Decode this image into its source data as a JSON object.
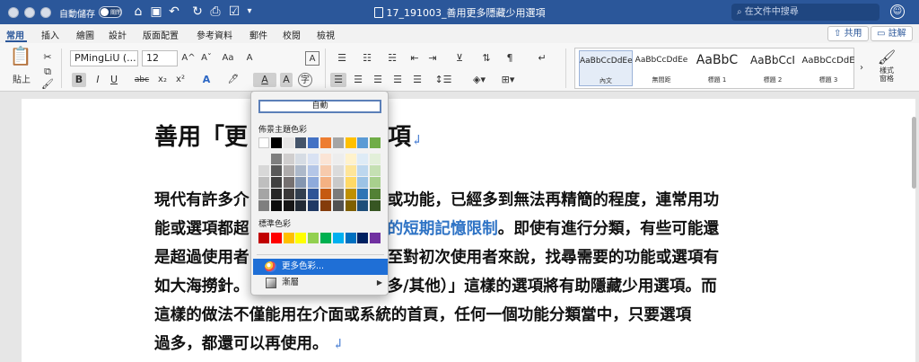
{
  "titlebar": {
    "autosave_label": "自動儲存",
    "autosave_state": "關閉",
    "doc_title": "17_191003_善用更多隱藏少用選項",
    "search_placeholder": "在文件中搜尋",
    "search_icon": "search-icon",
    "account_icon": "account-icon",
    "icons": [
      "home-icon",
      "save-icon",
      "undo-icon",
      "redo-icon",
      "print-icon",
      "checklist-icon",
      "dropdown-icon"
    ]
  },
  "tabs": [
    {
      "label": "常用",
      "active": true
    },
    {
      "label": "插入"
    },
    {
      "label": "繪圖"
    },
    {
      "label": "設計"
    },
    {
      "label": "版面配置"
    },
    {
      "label": "參考資料"
    },
    {
      "label": "郵件"
    },
    {
      "label": "校閱"
    },
    {
      "label": "檢視"
    }
  ],
  "share": {
    "share_label": "共用",
    "comment_label": "註解"
  },
  "ribbon": {
    "paste_label": "貼上",
    "font_name": "PMingLiU (...",
    "font_size": "12",
    "bold": "B",
    "italic": "I",
    "underline": "U",
    "strike": "abc",
    "subscript": "x₂",
    "superscript": "x²",
    "grow": "A^",
    "shrink": "Aˇ",
    "aa": "Aa",
    "clear": "A",
    "text_effects": "A",
    "highlight": "🖊",
    "font_color": "A",
    "shading": "A",
    "enclose": "字",
    "pinyin": "A"
  },
  "styles": [
    {
      "sample": "AaBbCcDdEe",
      "name": "內文",
      "selected": true
    },
    {
      "sample": "AaBbCcDdEe",
      "name": "無間距"
    },
    {
      "sample": "AaBbC",
      "name": "標題 1"
    },
    {
      "sample": "AaBbCcI",
      "name": "標題 2"
    },
    {
      "sample": "AaBbCcDdE",
      "name": "標題 3"
    }
  ],
  "style_pane_label": "樣式\n窗格",
  "document": {
    "heading_before": "善用「更",
    "heading_after": "用選項",
    "lines": [
      {
        "a": "現代有許多介",
        "b": "或功能，已經多到無法再精簡的程度，連常用功"
      },
      {
        "a": "能或選項都超",
        "link": "的短期記憶限制",
        "b": "。即使有進行分類，有些可能還"
      },
      {
        "a": "是超過使用者",
        "b": "至對初次使用者來說，找尋需要的功能或選項有"
      },
      {
        "a": "如大海撈針。",
        "b": "多/其他）」這樣的選項將有助隱藏少用選項。而"
      },
      {
        "a": "這樣的做法不僅能用在介面或系統的首頁，任何一個功能分類當中，只要選項",
        "b": ""
      },
      {
        "a": "過多，都還可以再使用。",
        "b": ""
      }
    ]
  },
  "color_menu": {
    "auto_label": "自動",
    "theme_label": "佈景主題色彩",
    "standard_label": "標準色彩",
    "more_colors_label": "更多色彩...",
    "gradient_label": "漸層",
    "theme_top": [
      "#ffffff",
      "#000000",
      "#e7e6e6",
      "#44546a",
      "#4472c4",
      "#ed7d31",
      "#a5a5a5",
      "#ffc000",
      "#5b9bd5",
      "#70ad47"
    ],
    "theme_shades": [
      [
        "#f2f2f2",
        "#7f7f7f",
        "#d0cece",
        "#d6dce4",
        "#d9e2f3",
        "#fbe4d5",
        "#ededed",
        "#fff2cc",
        "#deebf6",
        "#e2efd9"
      ],
      [
        "#d8d8d8",
        "#595959",
        "#aeabab",
        "#adb9ca",
        "#b4c6e7",
        "#f7caac",
        "#dbdbdb",
        "#fee599",
        "#bdd7ee",
        "#c5e0b3"
      ],
      [
        "#bfbfbf",
        "#3f3f3f",
        "#757070",
        "#8496b0",
        "#8eaadb",
        "#f4b183",
        "#c9c9c9",
        "#ffd966",
        "#9cc3e5",
        "#a8d08d"
      ],
      [
        "#a5a5a5",
        "#262626",
        "#3a3838",
        "#323f4f",
        "#2f5496",
        "#c55a11",
        "#7b7b7b",
        "#bf9000",
        "#2e75b5",
        "#538135"
      ],
      [
        "#7f7f7f",
        "#0c0c0c",
        "#171616",
        "#222a35",
        "#1f3864",
        "#843c0b",
        "#525252",
        "#7f6000",
        "#1e4e79",
        "#375623"
      ]
    ],
    "standard": [
      "#c00000",
      "#ff0000",
      "#ffc000",
      "#ffff00",
      "#92d050",
      "#00b050",
      "#00b0f0",
      "#0070c0",
      "#002060",
      "#7030a0"
    ]
  }
}
